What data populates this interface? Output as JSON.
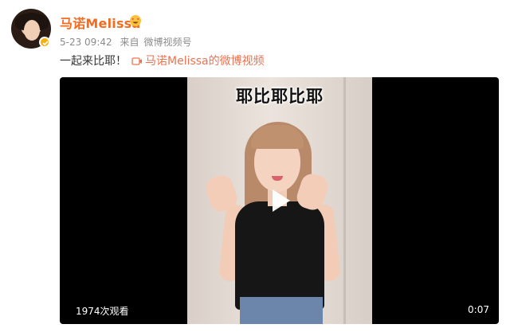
{
  "post": {
    "username": "马诺Melissa",
    "member_emoji": "heart-eyes-emoji",
    "date": "5-23 09:42",
    "source_prefix": "来自",
    "source": "微博视频号",
    "text": "一起来比耶！",
    "video_link": "马诺Melissa的微博视频"
  },
  "video": {
    "overlay_caption": "耶比耶比耶",
    "view_count": "1974次观看",
    "duration": "0:07"
  },
  "colors": {
    "username": "#f36c21",
    "link": "#eb7350",
    "meta": "#8b8b8b",
    "verified": "#f6b10c"
  }
}
